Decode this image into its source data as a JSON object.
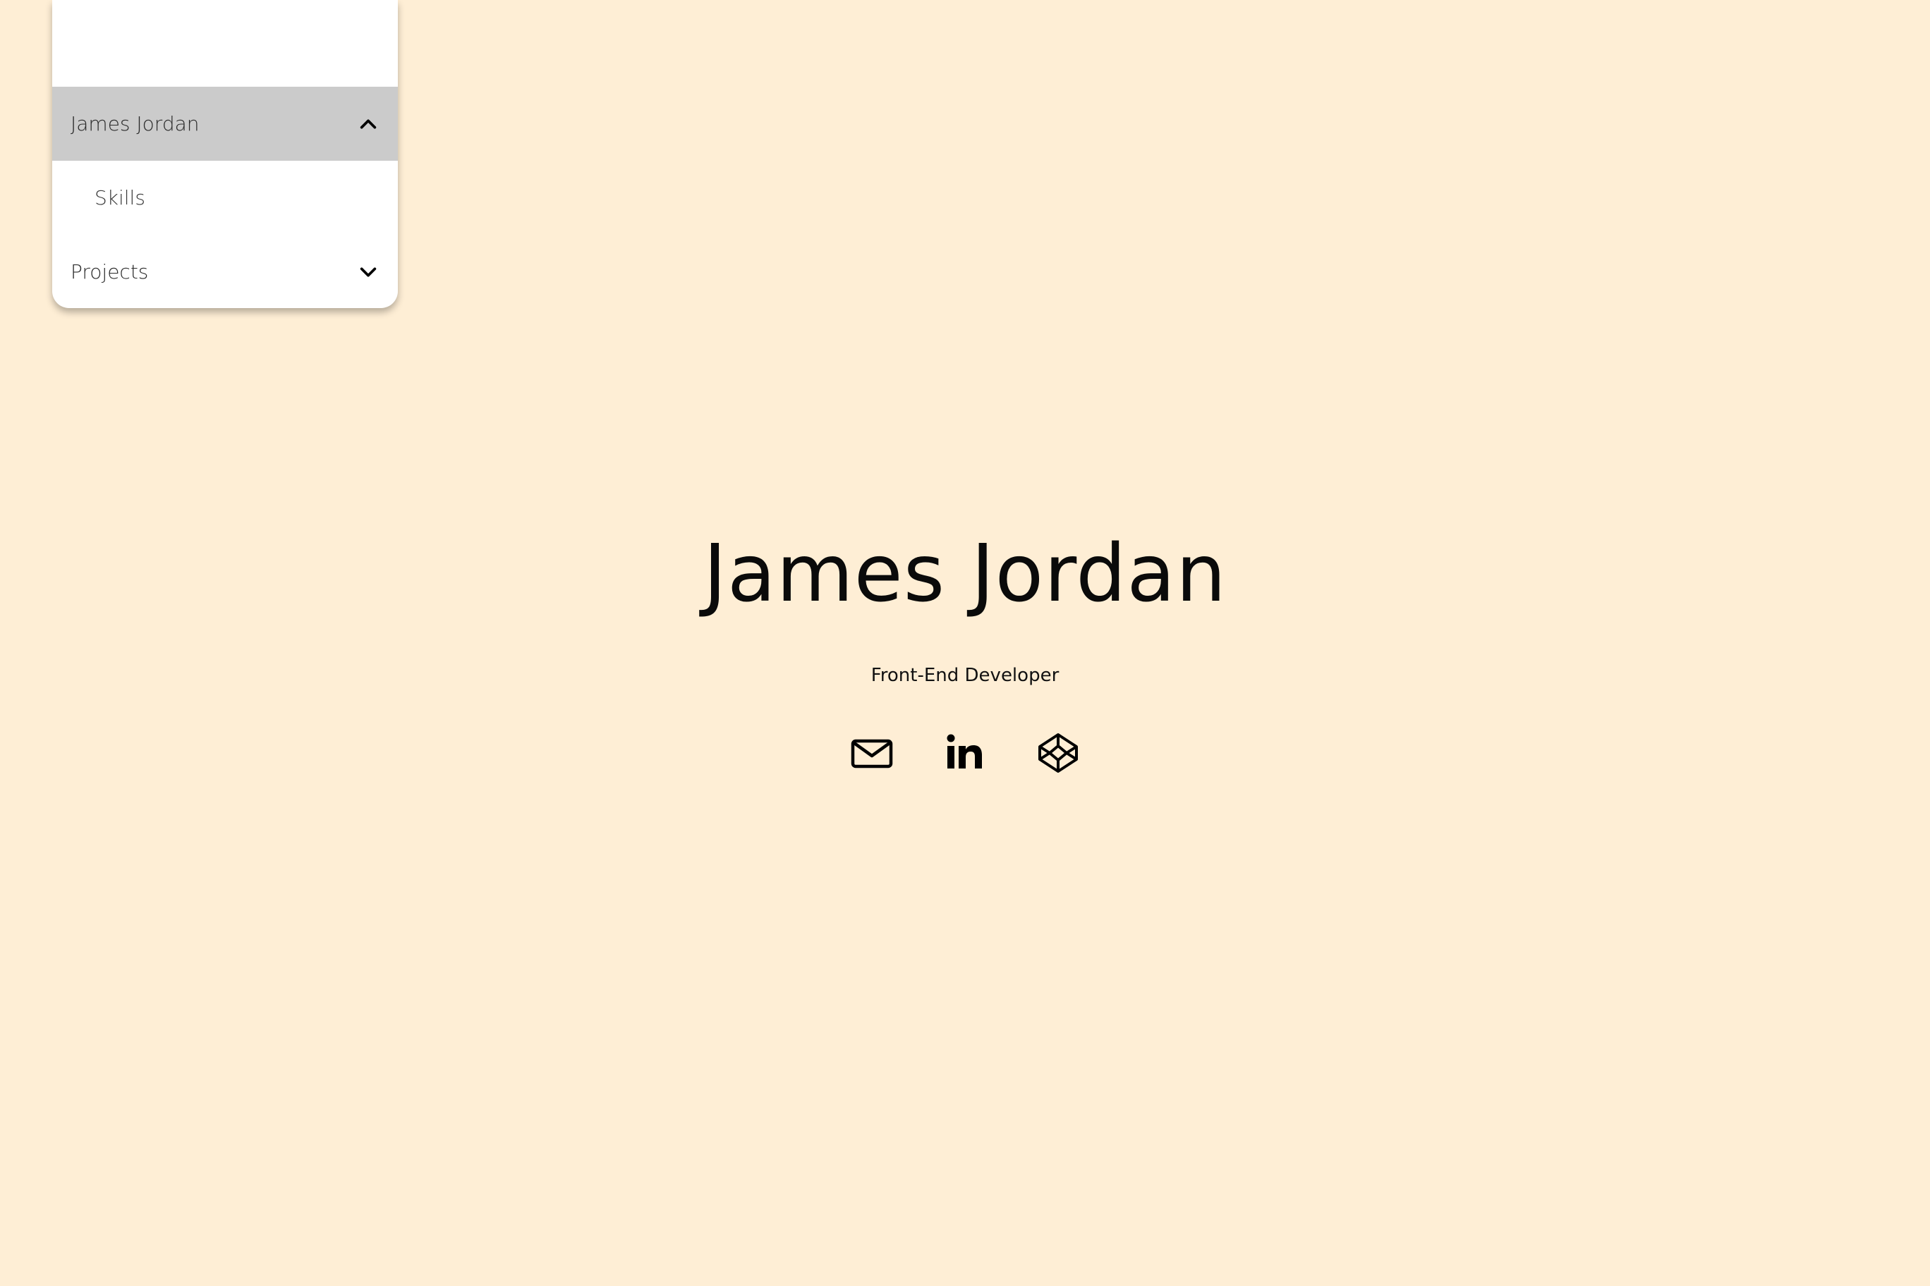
{
  "nav": {
    "items": [
      {
        "label": "James Jordan",
        "icon": "chevron-up-icon"
      },
      {
        "label": "Skills"
      },
      {
        "label": "Projects",
        "icon": "chevron-down-icon"
      }
    ]
  },
  "hero": {
    "name": "James Jordan",
    "role": "Front-End Developer"
  },
  "socials": [
    {
      "icon": "email-icon"
    },
    {
      "icon": "linkedin-icon"
    },
    {
      "icon": "codepen-icon"
    }
  ],
  "colors": {
    "background": "#feeed5",
    "nav_bg": "#ffffff",
    "nav_active": "#cbcbcb",
    "text": "#000000"
  }
}
